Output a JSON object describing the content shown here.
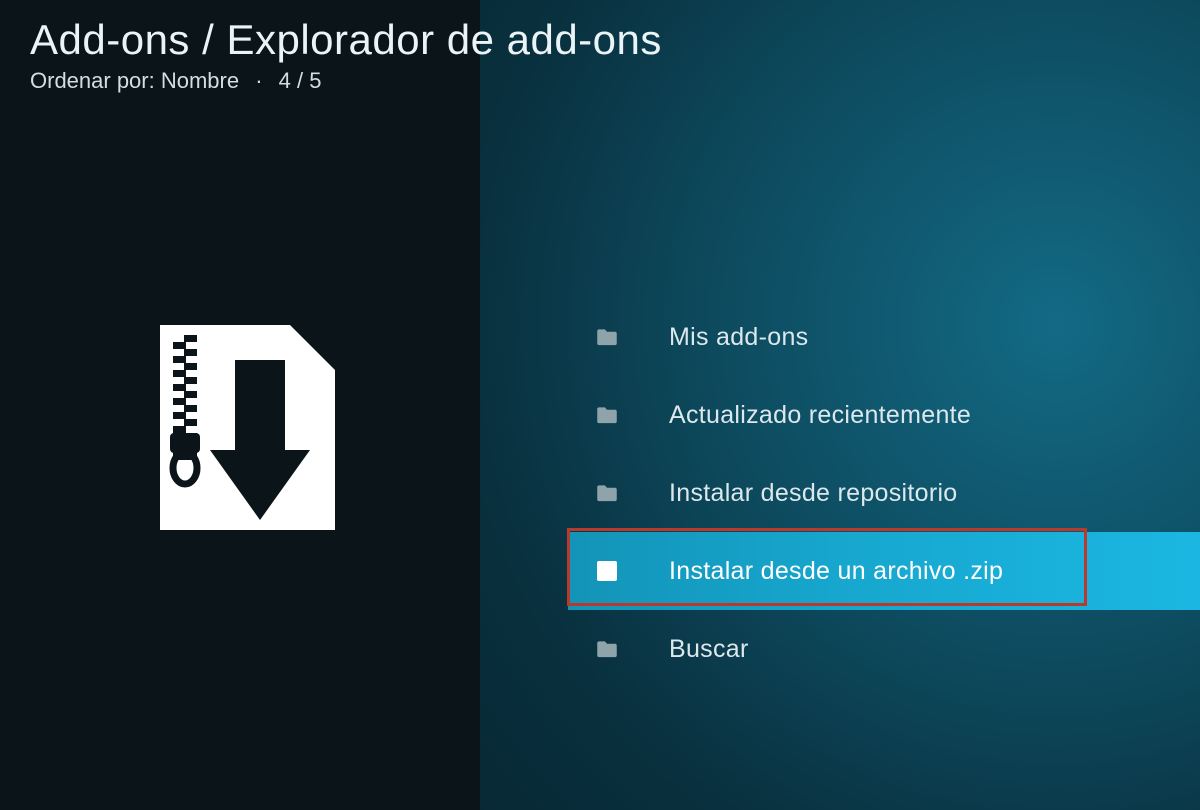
{
  "header": {
    "breadcrumb": "Add-ons / Explorador de add-ons",
    "sort_label": "Ordenar por: Nombre",
    "position": "4 / 5"
  },
  "menu": {
    "items": [
      {
        "label": "Mis add-ons",
        "icon": "folder",
        "selected": false
      },
      {
        "label": "Actualizado recientemente",
        "icon": "folder",
        "selected": false
      },
      {
        "label": "Instalar desde repositorio",
        "icon": "folder",
        "selected": false
      },
      {
        "label": "Instalar desde un archivo .zip",
        "icon": "file",
        "selected": true
      },
      {
        "label": "Buscar",
        "icon": "folder",
        "selected": false
      }
    ]
  }
}
